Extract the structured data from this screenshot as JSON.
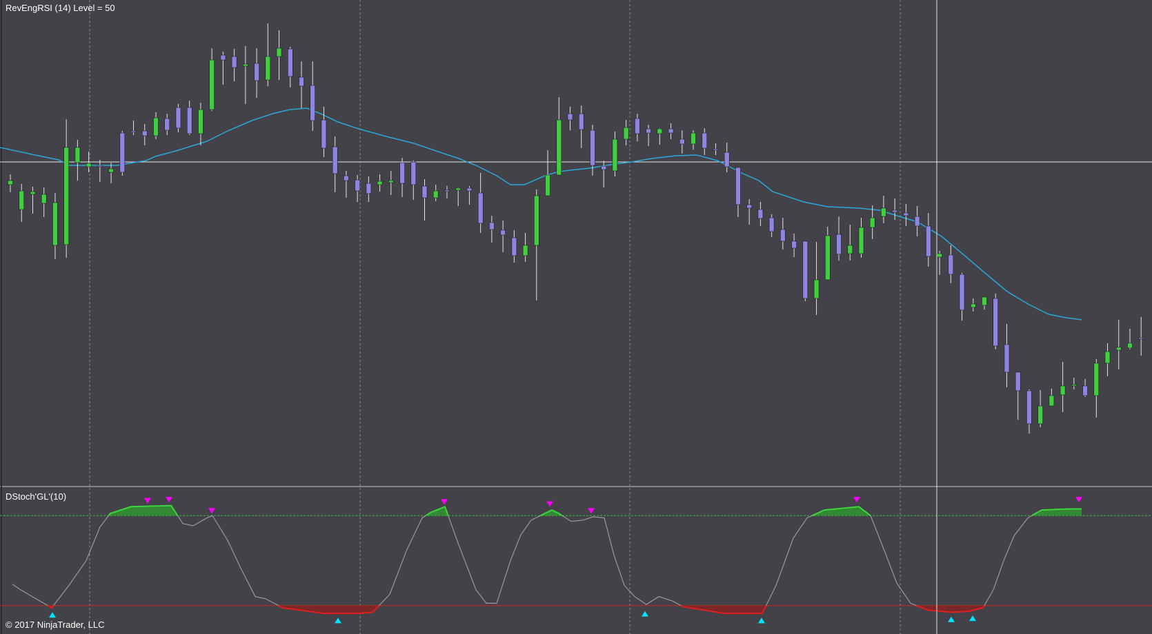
{
  "colors": {
    "background": "#424248",
    "panel_separator": "#c8c8c8",
    "up_candle": "#3fcf3f",
    "down_candle": "#8d86e0",
    "wick": "#e6e6e6",
    "rsi_line": "#2ba7d8",
    "level_line": "#e8e8e8",
    "grid_vertical": "#8a8a8a",
    "crosshair": "#e6e6e6",
    "stoch_line": "#9a9a9a",
    "stoch_upper_fill": "#2f9a2f",
    "stoch_upper_line": "#3dd63d",
    "stoch_lower_fill": "#8a2020",
    "stoch_lower_line": "#e01f1f",
    "upper_level_line": "#3cbf3c",
    "lower_level_line": "#d02424",
    "sell_marker": "#ff00ff",
    "buy_marker": "#00e5ff"
  },
  "labels": {
    "price_panel": "RevEngRSI (14) Level = 50",
    "indicator_panel": "DStoch'GL'(10)",
    "copyright": "© 2017 NinjaTrader, LLC"
  },
  "chart_data": [
    {
      "type": "candlestick",
      "title": "RevEngRSI (14) Level = 50",
      "ylim": [
        0,
        660
      ],
      "level": 235,
      "candles": [
        [
          268,
          262,
          279,
          253
        ],
        [
          304,
          277,
          322,
          267
        ],
        [
          282,
          278,
          310,
          271
        ],
        [
          295,
          282,
          315,
          272
        ],
        [
          356,
          294,
          376,
          280
        ],
        [
          355,
          214,
          374,
          173
        ],
        [
          236,
          214,
          262,
          203
        ],
        [
          242,
          237,
          250,
          220
        ],
        [
          240,
          242,
          264,
          232
        ],
        [
          250,
          245,
          266,
          236
        ],
        [
          193,
          250,
          255,
          190
        ],
        [
          190,
          190,
          196,
          175
        ],
        [
          190,
          197,
          211,
          180
        ],
        [
          197,
          171,
          202,
          163
        ],
        [
          172,
          189,
          196,
          165
        ],
        [
          156,
          186,
          192,
          151
        ],
        [
          156,
          194,
          196,
          146
        ],
        [
          194,
          159,
          211,
          149
        ],
        [
          159,
          87,
          161,
          70
        ],
        [
          80,
          87,
          123,
          75
        ],
        [
          82,
          98,
          118,
          71
        ],
        [
          96,
          93,
          151,
          67
        ],
        [
          92,
          117,
          142,
          70
        ],
        [
          116,
          82,
          125,
          34
        ],
        [
          82,
          70,
          116,
          44
        ],
        [
          71,
          111,
          127,
          68
        ],
        [
          112,
          125,
          157,
          89
        ],
        [
          124,
          175,
          190,
          89
        ],
        [
          174,
          215,
          228,
          155
        ],
        [
          213,
          252,
          279,
          198
        ],
        [
          255,
          262,
          287,
          248
        ],
        [
          261,
          277,
          293,
          254
        ],
        [
          266,
          281,
          293,
          256
        ],
        [
          268,
          263,
          278,
          253
        ],
        [
          265,
          262,
          283,
          248
        ],
        [
          236,
          266,
          286,
          229
        ],
        [
          235,
          268,
          290,
          233
        ],
        [
          270,
          287,
          320,
          260
        ],
        [
          287,
          277,
          292,
          268
        ],
        [
          276,
          276,
          288,
          270
        ],
        [
          276,
          273,
          299,
          272
        ],
        [
          273,
          277,
          297,
          270
        ],
        [
          280,
          324,
          338,
          251
        ],
        [
          323,
          333,
          352,
          313
        ],
        [
          334,
          341,
          366,
          320
        ],
        [
          345,
          371,
          381,
          334
        ],
        [
          371,
          356,
          380,
          338
        ],
        [
          356,
          284,
          436,
          275
        ],
        [
          284,
          254,
          271,
          218
        ],
        [
          254,
          174,
          244,
          141
        ],
        [
          165,
          174,
          189,
          155
        ],
        [
          165,
          188,
          215,
          153
        ],
        [
          189,
          240,
          255,
          181
        ],
        [
          241,
          246,
          272,
          233
        ],
        [
          248,
          202,
          256,
          191
        ],
        [
          202,
          185,
          211,
          174
        ],
        [
          172,
          194,
          205,
          165
        ],
        [
          187,
          193,
          212,
          181
        ],
        [
          194,
          187,
          210,
          186
        ],
        [
          187,
          193,
          202,
          179
        ],
        [
          202,
          209,
          223,
          189
        ],
        [
          209,
          193,
          217,
          189
        ],
        [
          193,
          215,
          225,
          186
        ],
        [
          216,
          218,
          225,
          208
        ],
        [
          221,
          242,
          250,
          207
        ],
        [
          243,
          297,
          315,
          270
        ],
        [
          297,
          302,
          326,
          289
        ],
        [
          304,
          317,
          328,
          293
        ],
        [
          316,
          336,
          344,
          311
        ],
        [
          333,
          350,
          362,
          316
        ],
        [
          350,
          360,
          373,
          339
        ],
        [
          350,
          433,
          437,
          374
        ],
        [
          433,
          406,
          457,
          351
        ],
        [
          406,
          342,
          385,
          329
        ],
        [
          340,
          369,
          378,
          314
        ],
        [
          368,
          356,
          378,
          326
        ],
        [
          368,
          330,
          374,
          316
        ],
        [
          330,
          316,
          347,
          298
        ],
        [
          314,
          302,
          324,
          284
        ],
        [
          305,
          308,
          319,
          288
        ],
        [
          309,
          313,
          328,
          296
        ],
        [
          314,
          328,
          343,
          299
        ],
        [
          328,
          372,
          387,
          309
        ],
        [
          373,
          368,
          399,
          364
        ],
        [
          370,
          398,
          411,
          356
        ],
        [
          398,
          450,
          465,
          396
        ],
        [
          446,
          441,
          452,
          433
        ],
        [
          443,
          431,
          449,
          431
        ],
        [
          433,
          502,
          507,
          426
        ],
        [
          500,
          540,
          562,
          470
        ],
        [
          540,
          567,
          609,
          541
        ],
        [
          567,
          615,
          629,
          565
        ],
        [
          615,
          589,
          620,
          566
        ],
        [
          589,
          574,
          586,
          564
        ],
        [
          573,
          560,
          598,
          525
        ],
        [
          560,
          558,
          565,
          548
        ],
        [
          560,
          574,
          576,
          550
        ],
        [
          574,
          527,
          606,
          521
        ],
        [
          527,
          510,
          546,
          498
        ],
        [
          508,
          504,
          536,
          464
        ],
        [
          505,
          498,
          507,
          477
        ],
        [
          490,
          490,
          516,
          460
        ]
      ],
      "rsi_line": [
        [
          0,
          214
        ],
        [
          51,
          225
        ],
        [
          85,
          232
        ],
        [
          100,
          240
        ],
        [
          125,
          240
        ],
        [
          170,
          240
        ],
        [
          187,
          237
        ],
        [
          212,
          233
        ],
        [
          225,
          227
        ],
        [
          255,
          219
        ],
        [
          300,
          205
        ],
        [
          330,
          190
        ],
        [
          365,
          175
        ],
        [
          395,
          165
        ],
        [
          420,
          159
        ],
        [
          445,
          157
        ],
        [
          465,
          165
        ],
        [
          490,
          177
        ],
        [
          520,
          187
        ],
        [
          560,
          198
        ],
        [
          600,
          208
        ],
        [
          635,
          220
        ],
        [
          665,
          230
        ],
        [
          690,
          240
        ],
        [
          720,
          255
        ],
        [
          740,
          268
        ],
        [
          760,
          268
        ],
        [
          790,
          255
        ],
        [
          810,
          249
        ],
        [
          835,
          246
        ],
        [
          855,
          244
        ],
        [
          885,
          239
        ],
        [
          915,
          235
        ],
        [
          945,
          230
        ],
        [
          980,
          226
        ],
        [
          1010,
          225
        ],
        [
          1040,
          233
        ],
        [
          1075,
          251
        ],
        [
          1100,
          262
        ],
        [
          1120,
          278
        ],
        [
          1165,
          293
        ],
        [
          1200,
          300
        ],
        [
          1245,
          302
        ],
        [
          1275,
          305
        ],
        [
          1300,
          313
        ],
        [
          1330,
          322
        ],
        [
          1365,
          343
        ],
        [
          1395,
          368
        ],
        [
          1430,
          398
        ],
        [
          1460,
          423
        ],
        [
          1490,
          441
        ],
        [
          1520,
          456
        ],
        [
          1545,
          461
        ],
        [
          1568,
          464
        ]
      ]
    },
    {
      "type": "line",
      "title": "DStoch'GL'(10)",
      "ylim": [
        0,
        100
      ],
      "upper_level": 90,
      "lower_level": 10,
      "series": [
        {
          "values": [
            [
              18,
              29
            ],
            [
              30,
              24
            ],
            [
              55,
              15
            ],
            [
              75,
              8
            ],
            [
              100,
              28
            ],
            [
              125,
              50
            ],
            [
              145,
              80
            ],
            [
              160,
              92
            ],
            [
              190,
              98
            ],
            [
              248,
              99
            ],
            [
              265,
              83
            ],
            [
              280,
              81
            ],
            [
              300,
              88
            ],
            [
              308,
              90
            ],
            [
              330,
              68
            ],
            [
              350,
              42
            ],
            [
              370,
              18
            ],
            [
              385,
              16
            ],
            [
              410,
              8
            ],
            [
              470,
              3
            ],
            [
              500,
              3
            ],
            [
              520,
              3
            ],
            [
              540,
              4
            ],
            [
              565,
              20
            ],
            [
              590,
              60
            ],
            [
              612,
              88
            ],
            [
              625,
              93
            ],
            [
              645,
              98
            ],
            [
              665,
              64
            ],
            [
              690,
              24
            ],
            [
              705,
              12
            ],
            [
              720,
              12
            ],
            [
              740,
              50
            ],
            [
              755,
              73
            ],
            [
              770,
              86
            ],
            [
              800,
              95
            ],
            [
              810,
              92
            ],
            [
              828,
              85
            ],
            [
              845,
              86
            ],
            [
              860,
              89
            ],
            [
              876,
              88
            ],
            [
              890,
              55
            ],
            [
              905,
              28
            ],
            [
              920,
              18
            ],
            [
              937,
              11
            ],
            [
              955,
              18
            ],
            [
              975,
              14
            ],
            [
              990,
              9
            ],
            [
              1050,
              3
            ],
            [
              1105,
              3
            ],
            [
              1125,
              28
            ],
            [
              1150,
              70
            ],
            [
              1170,
              88
            ],
            [
              1195,
              95
            ],
            [
              1245,
              98
            ],
            [
              1262,
              90
            ],
            [
              1280,
              62
            ],
            [
              1300,
              30
            ],
            [
              1320,
              12
            ],
            [
              1345,
              6
            ],
            [
              1380,
              4
            ],
            [
              1405,
              5
            ],
            [
              1425,
              8
            ],
            [
              1440,
              24
            ],
            [
              1455,
              50
            ],
            [
              1470,
              72
            ],
            [
              1490,
              88
            ],
            [
              1510,
              95
            ],
            [
              1550,
              96
            ],
            [
              1568,
              96
            ]
          ]
        }
      ],
      "sell_signals": [
        [
          214,
          99
        ],
        [
          245,
          100
        ],
        [
          307,
          90
        ],
        [
          644,
          98
        ],
        [
          797,
          96
        ],
        [
          857,
          90
        ],
        [
          1242,
          100
        ],
        [
          1564,
          100
        ]
      ],
      "buy_signals": [
        [
          76,
          6
        ],
        [
          490,
          1
        ],
        [
          935,
          7
        ],
        [
          1104,
          1
        ],
        [
          1379,
          2
        ],
        [
          1410,
          3
        ]
      ]
    }
  ]
}
